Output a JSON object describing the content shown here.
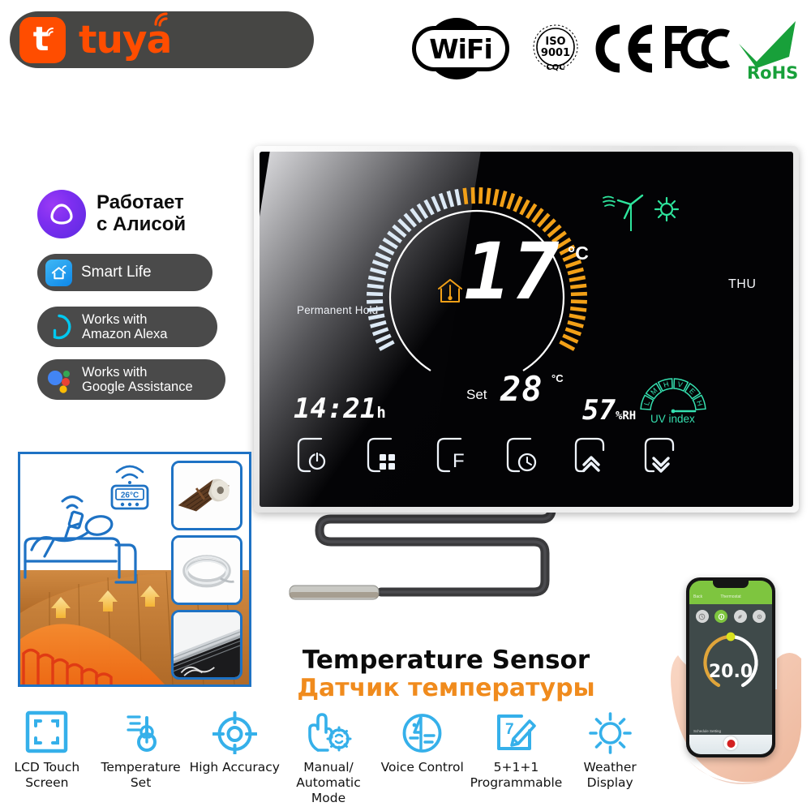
{
  "brand": {
    "tuya_label": "tuya",
    "tuya_icon": "tuya-t-wifi-icon"
  },
  "certifications": [
    {
      "name": "wifi-badge",
      "label": "WiFi"
    },
    {
      "name": "iso-badge",
      "label_top": "ISO",
      "label_num": "9001",
      "label_bottom": "CQC",
      "ring_text": "QUALITY SYSTEM CERTIFICATION"
    },
    {
      "name": "ce-badge",
      "label": "CE"
    },
    {
      "name": "fcc-badge",
      "label": "FCC"
    },
    {
      "name": "rohs-badge",
      "label": "RoHS",
      "color": "#18a03a"
    }
  ],
  "assistants": [
    {
      "name": "yandex-alice",
      "line1": "Работает",
      "line2": "с Алисой",
      "icon": "alice-logo-icon",
      "accent": "#7d2ef0"
    },
    {
      "name": "smart-life",
      "label": "Smart Life",
      "icon": "smart-home-wifi-icon",
      "accent": "#1e9bf0"
    },
    {
      "name": "amazon-alexa",
      "line1": "Works with",
      "line2": "Amazon Alexa",
      "icon": "alexa-ring-icon",
      "accent": "#00c8f0"
    },
    {
      "name": "google-assistance",
      "line1": "Works with",
      "line2": "Google Assistance",
      "icon": "google-assistant-dots-icon",
      "accent": "#4285f4"
    }
  ],
  "thermostat": {
    "mode_text": "Permanent Hold",
    "day": "THU",
    "current_temp": "17",
    "current_unit": "°C",
    "set_label": "Set",
    "set_temp": "28",
    "set_unit": "°C",
    "time": "14:21",
    "time_unit": "h",
    "humidity": "57",
    "humidity_unit": "%RH",
    "uv_label": "UV index",
    "uv_segments": [
      "L",
      "M",
      "H",
      "V",
      "E",
      "H"
    ],
    "dial": {
      "total_ticks": 56,
      "cold_ticks": 26,
      "warm_ticks": 30,
      "cold_color": "#dce9f5",
      "warm_color": "#f2a017"
    },
    "icons": {
      "house": "house-thermometer-icon",
      "wind": "wind-turbine-icon",
      "sun": "sun-icon"
    },
    "buttons": [
      {
        "name": "power-button",
        "glyph": "power-icon"
      },
      {
        "name": "mode-button",
        "glyph": "grid-squares-icon"
      },
      {
        "name": "function-button",
        "glyph": "F"
      },
      {
        "name": "timer-button",
        "glyph": "clock-icon"
      },
      {
        "name": "temp-up-button",
        "glyph": "chevron-up-icon"
      },
      {
        "name": "temp-down-button",
        "glyph": "chevron-down-icon"
      }
    ]
  },
  "sensor": {
    "title_en": "Temperature Sensor",
    "title_ru": "Датчик температуры",
    "title_ru_color": "#f08b1d"
  },
  "illustration": {
    "mini_thermostat_temp": "26°C",
    "thumbnails": [
      {
        "name": "carbon-film-roll-thumbnail"
      },
      {
        "name": "heating-cable-coil-thumbnail"
      },
      {
        "name": "heating-mat-thumbnail"
      }
    ]
  },
  "features": [
    {
      "name": "lcd-touch-screen",
      "icon": "crop-frame-icon",
      "line1": "LCD Touch",
      "line2": "Screen"
    },
    {
      "name": "temperature-set",
      "icon": "thermometer-icon",
      "line1": "Temperature Set",
      "line2": ""
    },
    {
      "name": "high-accuracy",
      "icon": "target-crosshair-icon",
      "line1": "High Accuracy",
      "line2": ""
    },
    {
      "name": "manual-automatic-mode",
      "icon": "hand-tap-gear-icon",
      "line1": "Manual/",
      "line2": "Automatic Mode"
    },
    {
      "name": "voice-control",
      "icon": "voice-profile-icon",
      "line1": "Voice Control",
      "line2": ""
    },
    {
      "name": "programmable",
      "icon": "schedule-pencil-icon",
      "line1": "5+1+1",
      "line2": "Programmable"
    },
    {
      "name": "weather-display",
      "icon": "sun-rays-icon",
      "line1": "Weather",
      "line2": "Display"
    }
  ],
  "phone_app": {
    "header_title": "Thermostat",
    "back_label": "Back",
    "temperature": "20.0",
    "schedule_label": "Schedule Setting",
    "accent": "#7ec53f",
    "modes": [
      "mode-auto",
      "mode-manual",
      "mode-eco",
      "mode-settings"
    ]
  }
}
